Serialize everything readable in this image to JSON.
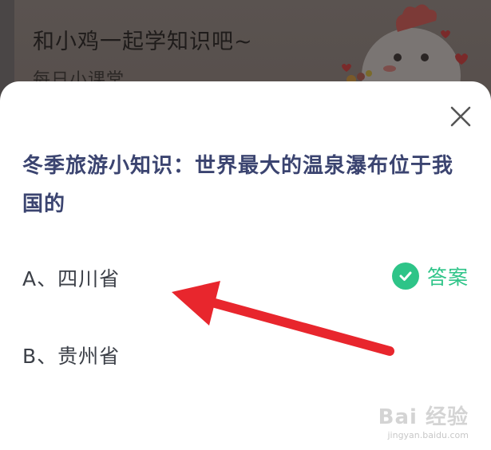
{
  "background_card": {
    "title": "和小鸡一起学知识吧~",
    "subtitle": "每日小课堂"
  },
  "modal": {
    "close_icon": "close-icon",
    "question": "冬季旅游小知识：世界最大的温泉瀑布位于我国的",
    "options": [
      {
        "label": "A、四川省",
        "is_answer": true
      },
      {
        "label": "B、贵州省",
        "is_answer": false
      }
    ],
    "answer_tag": {
      "icon": "check-circle-icon",
      "label": "答案"
    }
  },
  "colors": {
    "question_text": "#3b4470",
    "answer_green": "#2ec488",
    "arrow_red": "#e8262d"
  },
  "watermark": {
    "logo": "Bai 经验",
    "url": "jingyan.baidu.com"
  }
}
